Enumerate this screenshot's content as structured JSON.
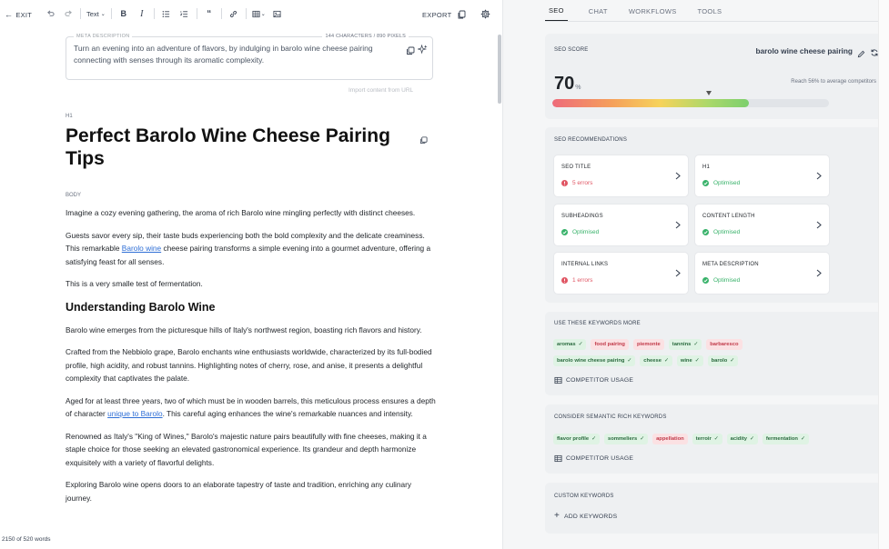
{
  "toolbar": {
    "exit_label": "EXIT",
    "text_style_label": "Text",
    "export_label": "EXPORT"
  },
  "editor": {
    "meta": {
      "label": "META DESCRIPTION",
      "count": "144 CHARACTERS / 890 PIXELS",
      "text": "Turn an evening into an adventure of flavors, by indulging in barolo wine cheese pairing connecting with senses through its aromatic complexity."
    },
    "import_link": "Import content from URL",
    "h1_tag": "H1",
    "title": "Perfect Barolo Wine Cheese Pairing Tips",
    "body_tag": "BODY",
    "p1": "Imagine a cozy evening gathering, the aroma of rich Barolo wine mingling perfectly with distinct cheeses.",
    "p2_before": "Guests savor every sip, their taste buds experiencing both the bold complexity and the delicate creaminess. This remarkable ",
    "p2_link": "Barolo wine",
    "p2_after": " cheese pairing transforms a simple evening into a gourmet adventure, offering a satisfying feast for all senses.",
    "p3": "This is a very smalle test of fermentation.",
    "h2": "Understanding Barolo Wine",
    "p4": "Barolo wine emerges from the picturesque hills of Italy's northwest region, boasting rich flavors and history.",
    "p5": "Crafted from the Nebbiolo grape, Barolo enchants wine enthusiasts worldwide, characterized by its full-bodied profile, high acidity, and robust tannins. Highlighting notes of cherry, rose, and anise, it presents a delightful complexity that captivates the palate.",
    "p6_before": "Aged for at least three years, two of which must be in wooden barrels, this meticulous process ensures a depth of character ",
    "p6_link": "unique to Barolo",
    "p6_after": ". This careful aging enhances the wine's remarkable nuances and intensity.",
    "p7": "Renowned as Italy's \"King of Wines,\" Barolo's majestic nature pairs beautifully with fine cheeses, making it a staple choice for those seeking an elevated gastronomical experience. Its grandeur and depth harmonize exquisitely with a variety of flavorful delights.",
    "p8": "Exploring Barolo wine opens doors to an elaborate tapestry of taste and tradition, enriching any culinary journey.",
    "word_count": "2150 of 520 words"
  },
  "panel": {
    "tabs": [
      "SEO",
      "CHAT",
      "WORKFLOWS",
      "TOOLS"
    ],
    "score": {
      "heading": "SEO SCORE",
      "keyword": "barolo wine cheese pairing",
      "value": "70",
      "unit": "%",
      "hint": "Reach 56% to average competitors",
      "fill_fraction": 0.71,
      "marker_fraction": 0.56
    },
    "recommendations": {
      "heading": "SEO RECOMMENDATIONS",
      "items": [
        {
          "title": "SEO TITLE",
          "status": "5 errors",
          "state": "error"
        },
        {
          "title": "H1",
          "status": "Optimised",
          "state": "ok"
        },
        {
          "title": "SUBHEADINGS",
          "status": "Optimised",
          "state": "ok"
        },
        {
          "title": "CONTENT LENGTH",
          "status": "Optimised",
          "state": "ok"
        },
        {
          "title": "INTERNAL LINKS",
          "status": "1 errors",
          "state": "error"
        },
        {
          "title": "META DESCRIPTION",
          "status": "Optimised",
          "state": "ok"
        }
      ]
    },
    "use_keywords": {
      "heading": "USE THESE KEYWORDS MORE",
      "chips": [
        {
          "text": "aromas",
          "state": "ok"
        },
        {
          "text": "food pairing",
          "state": "bad"
        },
        {
          "text": "piemonte",
          "state": "bad"
        },
        {
          "text": "tannins",
          "state": "ok"
        },
        {
          "text": "barbaresco",
          "state": "bad"
        },
        {
          "text": "barolo wine cheese pairing",
          "state": "ok"
        },
        {
          "text": "cheese",
          "state": "ok"
        },
        {
          "text": "wine",
          "state": "ok"
        },
        {
          "text": "barolo",
          "state": "ok"
        }
      ],
      "competitor_label": "COMPETITOR USAGE"
    },
    "semantic_keywords": {
      "heading": "CONSIDER SEMANTIC RICH KEYWORDS",
      "chips": [
        {
          "text": "flavor profile",
          "state": "ok"
        },
        {
          "text": "sommeliers",
          "state": "ok"
        },
        {
          "text": "appellation",
          "state": "bad"
        },
        {
          "text": "terroir",
          "state": "ok"
        },
        {
          "text": "acidity",
          "state": "ok"
        },
        {
          "text": "fermentation",
          "state": "ok"
        }
      ],
      "competitor_label": "COMPETITOR USAGE"
    },
    "custom_keywords": {
      "heading": "CUSTOM KEYWORDS",
      "add_label": "ADD KEYWORDS"
    }
  },
  "colors": {
    "link": "#2f6fd6",
    "error": "#e05563",
    "ok": "#38b26a",
    "chip_ok_bg": "#dff3e4",
    "chip_bad_bg": "#fbe1e3"
  },
  "icons": [
    "arrow-left-icon",
    "undo-icon",
    "redo-icon",
    "bold-icon",
    "italic-icon",
    "bullet-list-icon",
    "numbered-list-icon",
    "quote-icon",
    "link-icon",
    "table-icon",
    "image-icon",
    "copy-icon",
    "gear-icon",
    "sparkle-icon",
    "pencil-icon",
    "refresh-icon",
    "alert-icon",
    "check-circle-icon",
    "chevron-right-icon",
    "table-grid-icon",
    "plus-icon"
  ]
}
